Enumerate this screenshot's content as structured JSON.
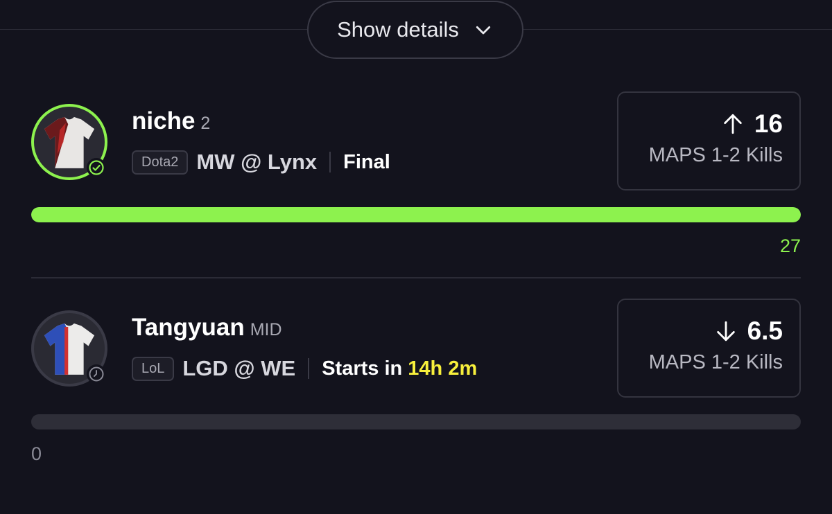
{
  "header": {
    "show_details_label": "Show details"
  },
  "players": [
    {
      "name": "niche",
      "sub": "2",
      "game_tag": "Dota2",
      "match": "MW @ Lynx",
      "status_text": "Final",
      "status_highlight": "",
      "line_direction": "up",
      "line_value": "16",
      "line_label": "MAPS 1-2 Kills",
      "progress_fraction": 1.0,
      "progress_value": "27",
      "state": "complete",
      "accent": "#8df24e"
    },
    {
      "name": "Tangyuan",
      "sub": "MID",
      "game_tag": "LoL",
      "match": "LGD @ WE",
      "status_text": "Starts in ",
      "status_highlight": "14h 2m",
      "line_direction": "down",
      "line_value": "6.5",
      "line_label": "MAPS 1-2 Kills",
      "progress_fraction": 0.0,
      "progress_value": "0",
      "state": "upcoming",
      "accent": "#f8f03c"
    }
  ],
  "icons": {
    "chevron": "chevron-down-icon",
    "check": "check-circle-icon",
    "clock": "clock-icon",
    "up": "arrow-up-icon",
    "down": "arrow-down-icon"
  }
}
